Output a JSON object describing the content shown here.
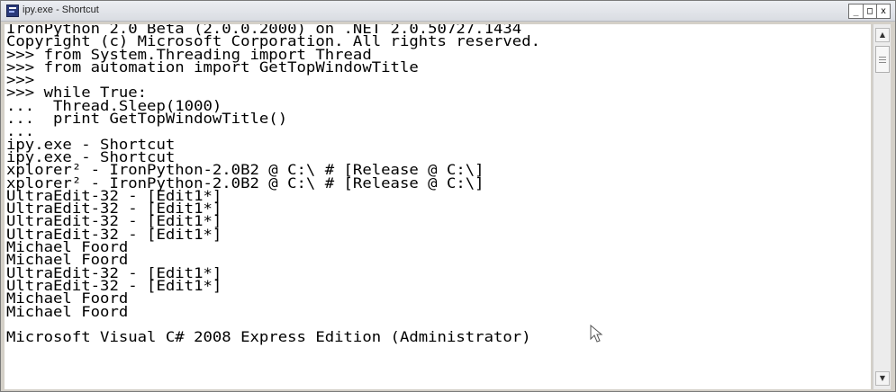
{
  "window": {
    "title": "ipy.exe - Shortcut",
    "controls": {
      "minimize": "_",
      "maximize": "□",
      "close": "x"
    }
  },
  "console": {
    "lines": [
      "IronPython 2.0 Beta (2.0.0.2000) on .NET 2.0.50727.1434",
      "Copyright (c) Microsoft Corporation. All rights reserved.",
      ">>> from System.Threading import Thread",
      ">>> from automation import GetTopWindowTitle",
      ">>>",
      ">>> while True:",
      "...  Thread.Sleep(1000)",
      "...  print GetTopWindowTitle()",
      "...",
      "ipy.exe - Shortcut",
      "ipy.exe - Shortcut",
      "xplorer² - IronPython-2.0B2 @ C:\\ # [Release @ C:\\]",
      "xplorer² - IronPython-2.0B2 @ C:\\ # [Release @ C:\\]",
      "UltraEdit-32 - [Edit1*]",
      "UltraEdit-32 - [Edit1*]",
      "UltraEdit-32 - [Edit1*]",
      "UltraEdit-32 - [Edit1*]",
      "Michael Foord",
      "Michael Foord",
      "UltraEdit-32 - [Edit1*]",
      "UltraEdit-32 - [Edit1*]",
      "Michael Foord",
      "Michael Foord",
      "",
      "Microsoft Visual C# 2008 Express Edition (Administrator)"
    ]
  },
  "scrollbar": {
    "up_glyph": "▲",
    "down_glyph": "▼"
  },
  "icons": {
    "window": "console-app-icon",
    "pointer": "mouse-pointer-icon"
  },
  "colors": {
    "background": "#d4d0c8",
    "console_bg": "#ffffff",
    "text": "#000000"
  }
}
